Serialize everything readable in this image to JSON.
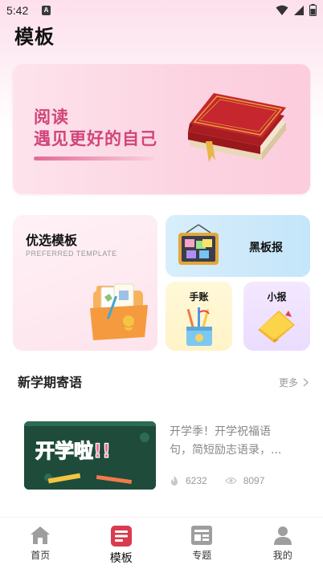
{
  "status_bar": {
    "time": "5:42",
    "notification_badge": "A"
  },
  "page": {
    "title": "模板"
  },
  "hero": {
    "line1": "阅读",
    "line2": "遇见更好的自己"
  },
  "preferred": {
    "title": "优选模板",
    "subtitle": "PREFERRED TEMPLATE"
  },
  "categories": {
    "blackboard": "黑板报",
    "journal": "手账",
    "newspaper": "小报"
  },
  "section": {
    "title": "新学期寄语",
    "more": "更多"
  },
  "article": {
    "thumb_text": "开学啦!!",
    "desc_line1": "开学季！开学祝福语",
    "desc_line2": "句，简短励志语录，...",
    "likes": "6232",
    "views": "8097"
  },
  "nav": [
    {
      "label": "首页",
      "icon": "home-icon"
    },
    {
      "label": "模板",
      "icon": "template-icon"
    },
    {
      "label": "专题",
      "icon": "topic-icon"
    },
    {
      "label": "我的",
      "icon": "profile-icon"
    }
  ],
  "colors": {
    "accent": "#d93b4f",
    "hero_text": "#d1447a"
  }
}
